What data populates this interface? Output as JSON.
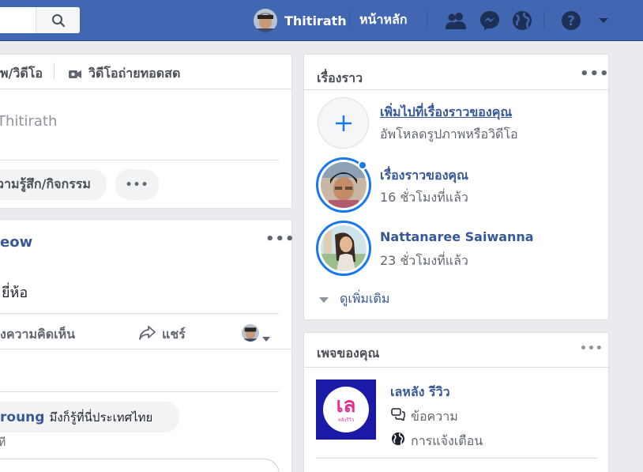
{
  "topbar": {
    "user_name": "Thitirath",
    "home_label": "หน้าหลัก"
  },
  "composer": {
    "tab_photo": "พ/วิดีโอ",
    "tab_live": "วิดีโอถ่ายทอดสด",
    "placeholder_name": "Thitirath",
    "feeling_label": "วามรู้สึก/กิจกรรม",
    "more_label": "•••"
  },
  "post": {
    "author_partial": "eow",
    "more_label": "•••",
    "text_partial": "ยี่ห้อ",
    "comment_label": "งความคิดเห็น",
    "share_label": "แชร์",
    "comment_author": "roung",
    "comment_text": "มึงก็รู้ที่นี่ประเทศไทย",
    "comment_time": "ที"
  },
  "stories": {
    "title": "เรื่องราว",
    "more_label": "•••",
    "add_title": "เพิ่มไปที่เรื่องราวของคุณ",
    "add_sub": "อัพโหลดรูปภาพหรือวิดีโอ",
    "items": [
      {
        "name": "เรื่องราวของคุณ",
        "time": "16 ชั่วโมงที่แล้ว"
      },
      {
        "name": "Nattanaree Saiwanna",
        "time": "23 ชั่วโมงที่แล้ว"
      }
    ],
    "see_more": "ดูเพิ่มเติม"
  },
  "pages": {
    "title": "เพจของคุณ",
    "more_label": "•••",
    "page_name": "เลหลัง รีวิว",
    "logo_text": "เล",
    "logo_sub": "หลังรีวิว",
    "messages_label": "ข้อความ",
    "notifications_label": "การแจ้งเตือน"
  },
  "colors": {
    "nav_blue": "#4267b2",
    "link_blue": "#385898",
    "story_ring": "#1877f2",
    "logo_bg": "#1a1aa6",
    "logo_pink": "#e8318f"
  }
}
